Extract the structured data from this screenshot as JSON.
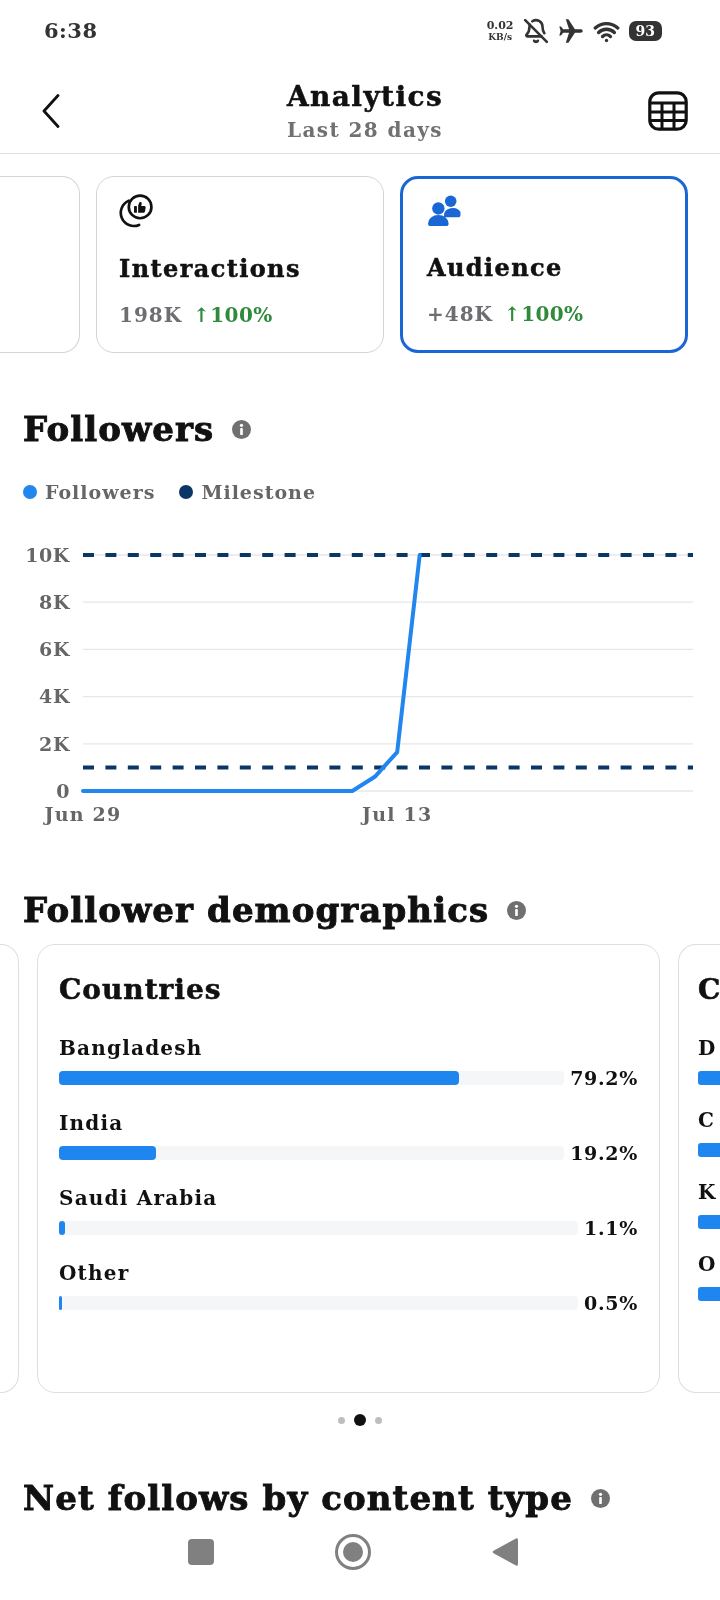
{
  "status_bar": {
    "time": "6:38",
    "net_speed": "0.02",
    "net_unit": "KB/s",
    "battery": "93"
  },
  "header": {
    "title": "Analytics",
    "subtitle": "Last 28 days"
  },
  "metric_cards": [
    {
      "kind": "interactions",
      "title": "Interactions",
      "value": "198K",
      "change": "↑100%",
      "selected": false
    },
    {
      "kind": "audience",
      "title": "Audience",
      "value": "+48K",
      "change": "↑100%",
      "selected": true
    }
  ],
  "followers": {
    "title": "Followers",
    "chart_data": {
      "type": "line",
      "categories": [
        "Jun 29",
        null,
        null,
        null,
        null,
        null,
        null,
        null,
        null,
        null,
        null,
        null,
        null,
        null,
        "Jul 13",
        null,
        null,
        null,
        null,
        null,
        null,
        null,
        null,
        null,
        null,
        null,
        null,
        null
      ],
      "series": [
        {
          "name": "Followers",
          "color": "#2187ee",
          "values": [
            0,
            0,
            0,
            0,
            0,
            0,
            0,
            0,
            0,
            0,
            0,
            0,
            0,
            600,
            1650,
            10000,
            null,
            null,
            null,
            null,
            null,
            null,
            null,
            null,
            null,
            null,
            null,
            null
          ]
        }
      ],
      "ylim": [
        0,
        10000
      ],
      "yticks": [
        {
          "value": 0,
          "label": "0"
        },
        {
          "value": 2000,
          "label": "2K"
        },
        {
          "value": 4000,
          "label": "4K"
        },
        {
          "value": 6000,
          "label": "6K"
        },
        {
          "value": 8000,
          "label": "8K"
        },
        {
          "value": 10000,
          "label": "10K"
        }
      ],
      "grid": true,
      "ref_lines": [
        {
          "axis": "y",
          "value": 10000,
          "label": "Milestone",
          "color": "#0b3766"
        },
        {
          "axis": "y",
          "value": 1000,
          "color": "#0b3766"
        }
      ]
    }
  },
  "demographics": {
    "title": "Follower demographics",
    "cards": [
      {
        "kind": "current",
        "title": "Countries",
        "rows": [
          {
            "label": "Bangladesh",
            "level": 0.792,
            "reading": "79.2%"
          },
          {
            "label": "India",
            "level": 0.192,
            "reading": "19.2%"
          },
          {
            "label": "Saudi Arabia",
            "level": 0.011,
            "reading": "1.1%"
          },
          {
            "label": "Other",
            "level": 0.005,
            "reading": "0.5%"
          }
        ]
      },
      {
        "kind": "next",
        "title": "C",
        "rows": [
          {
            "label": "D"
          },
          {
            "label": "C"
          },
          {
            "label": "K"
          },
          {
            "label": "O"
          }
        ]
      }
    ],
    "pages": [
      {
        "selected": false
      },
      {
        "selected": true
      },
      {
        "selected": false
      }
    ]
  },
  "next_section": {
    "title": "Net follows by content type"
  }
}
